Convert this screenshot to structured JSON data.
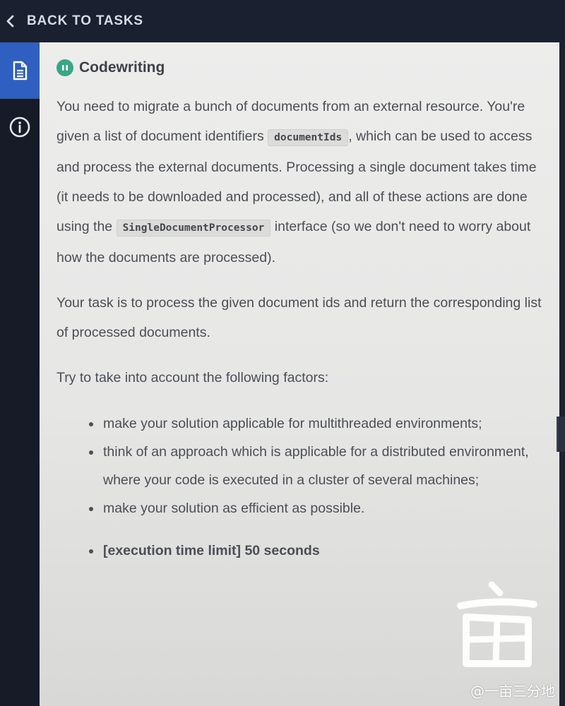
{
  "header": {
    "back_label": "BACK TO TASKS"
  },
  "sidebar": {
    "items": [
      {
        "icon": "document-icon",
        "active": true
      },
      {
        "icon": "info-icon",
        "active": false
      }
    ]
  },
  "task": {
    "title": "Codewriting",
    "description": {
      "p1_a": "You need to migrate a bunch of documents from an external resource. You're given a list of document identifiers ",
      "code1": "documentIds",
      "p1_b": ", which can be used to access and process the external documents. Processing a single document takes time (it needs to be downloaded and processed), and all of these actions are done using the ",
      "code2": "SingleDocumentProcessor",
      "p1_c": " interface (so we don't need to worry about how the documents are processed).",
      "p2": "Your task is to process the given document ids and return the corresponding list of processed documents.",
      "p3": "Try to take into account the following factors:"
    },
    "factors": [
      "make your solution applicable for multithreaded environments;",
      "think of an approach which is applicable for a distributed environment, where your code is executed in a cluster of several machines;",
      "make your solution as efficient as possible."
    ],
    "limit": "[execution time limit] 50 seconds"
  },
  "watermark": {
    "text": "@一亩三分地"
  },
  "colors": {
    "accent_blue": "#2f5fc0",
    "title_icon_green": "#3aa587"
  }
}
